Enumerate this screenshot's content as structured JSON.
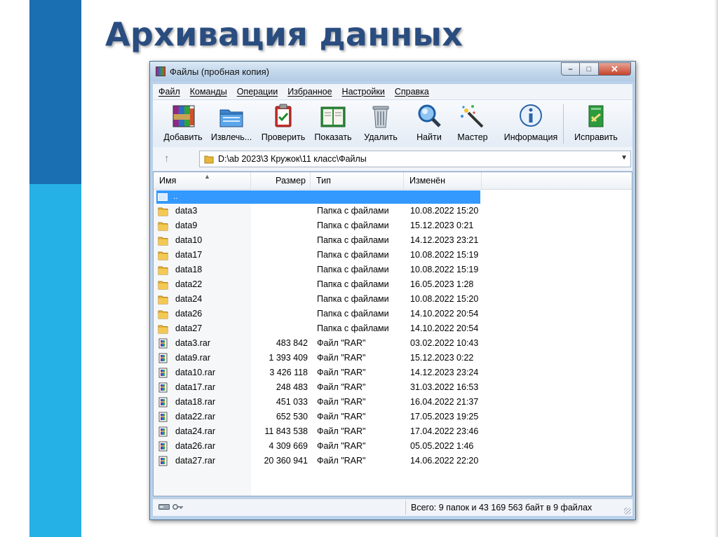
{
  "slide": {
    "title": "Архивация данных"
  },
  "window": {
    "title": "Файлы (пробная копия)",
    "caption_buttons": {
      "minimize": "–",
      "maximize": "□",
      "close": "✕"
    }
  },
  "menu": [
    "Файл",
    "Команды",
    "Операции",
    "Избранное",
    "Настройки",
    "Справка"
  ],
  "toolbar": [
    {
      "label": "Добавить",
      "icon": "add-archive-icon"
    },
    {
      "label": "Извлечь...",
      "icon": "extract-icon"
    },
    {
      "label": "Проверить",
      "icon": "test-icon"
    },
    {
      "label": "Показать",
      "icon": "view-book-icon"
    },
    {
      "label": "Удалить",
      "icon": "trash-icon"
    },
    {
      "label": "Найти",
      "icon": "magnifier-icon"
    },
    {
      "label": "Мастер",
      "icon": "wizard-wand-icon"
    },
    {
      "label": "Информация",
      "icon": "info-icon"
    },
    {
      "label": "Исправить",
      "icon": "repair-icon"
    }
  ],
  "address": {
    "up_arrow": "↑",
    "path": "D:\\ab 2023\\3 Кружок\\11 класс\\Файлы"
  },
  "columns": {
    "name": "Имя",
    "size": "Размер",
    "type": "Тип",
    "modified": "Изменён"
  },
  "parent_row": "..",
  "rows": [
    {
      "name": "data3",
      "size": "",
      "type": "Папка с файлами",
      "modified": "10.08.2022 15:20",
      "kind": "folder"
    },
    {
      "name": "data9",
      "size": "",
      "type": "Папка с файлами",
      "modified": "15.12.2023 0:21",
      "kind": "folder"
    },
    {
      "name": "data10",
      "size": "",
      "type": "Папка с файлами",
      "modified": "14.12.2023 23:21",
      "kind": "folder"
    },
    {
      "name": "data17",
      "size": "",
      "type": "Папка с файлами",
      "modified": "10.08.2022 15:19",
      "kind": "folder"
    },
    {
      "name": "data18",
      "size": "",
      "type": "Папка с файлами",
      "modified": "10.08.2022 15:19",
      "kind": "folder"
    },
    {
      "name": "data22",
      "size": "",
      "type": "Папка с файлами",
      "modified": "16.05.2023 1:28",
      "kind": "folder"
    },
    {
      "name": "data24",
      "size": "",
      "type": "Папка с файлами",
      "modified": "10.08.2022 15:20",
      "kind": "folder"
    },
    {
      "name": "data26",
      "size": "",
      "type": "Папка с файлами",
      "modified": "14.10.2022 20:54",
      "kind": "folder"
    },
    {
      "name": "data27",
      "size": "",
      "type": "Папка с файлами",
      "modified": "14.10.2022 20:54",
      "kind": "folder"
    },
    {
      "name": "data3.rar",
      "size": "483 842",
      "type": "Файл \"RAR\"",
      "modified": "03.02.2022 10:43",
      "kind": "rar"
    },
    {
      "name": "data9.rar",
      "size": "1 393 409",
      "type": "Файл \"RAR\"",
      "modified": "15.12.2023 0:22",
      "kind": "rar"
    },
    {
      "name": "data10.rar",
      "size": "3 426 118",
      "type": "Файл \"RAR\"",
      "modified": "14.12.2023 23:24",
      "kind": "rar"
    },
    {
      "name": "data17.rar",
      "size": "248 483",
      "type": "Файл \"RAR\"",
      "modified": "31.03.2022 16:53",
      "kind": "rar"
    },
    {
      "name": "data18.rar",
      "size": "451 033",
      "type": "Файл \"RAR\"",
      "modified": "16.04.2022 21:37",
      "kind": "rar"
    },
    {
      "name": "data22.rar",
      "size": "652 530",
      "type": "Файл \"RAR\"",
      "modified": "17.05.2023 19:25",
      "kind": "rar"
    },
    {
      "name": "data24.rar",
      "size": "11 843 538",
      "type": "Файл \"RAR\"",
      "modified": "17.04.2022 23:46",
      "kind": "rar"
    },
    {
      "name": "data26.rar",
      "size": "4 309 669",
      "type": "Файл \"RAR\"",
      "modified": "05.05.2022 1:46",
      "kind": "rar"
    },
    {
      "name": "data27.rar",
      "size": "20 360 941",
      "type": "Файл \"RAR\"",
      "modified": "14.06.2022 22:20",
      "kind": "rar"
    }
  ],
  "status": {
    "text": "Всего: 9 папок и 43 169 563 байт в 9 файлах"
  }
}
